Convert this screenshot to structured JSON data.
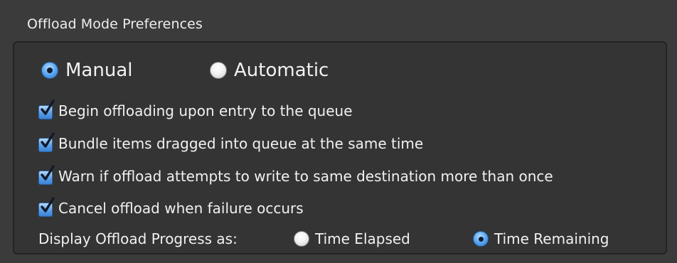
{
  "window": {
    "group_title": "Offload Mode Preferences"
  },
  "mode": {
    "options": [
      {
        "label": "Manual",
        "selected": true
      },
      {
        "label": "Automatic",
        "selected": false
      }
    ]
  },
  "options": {
    "items": [
      {
        "label": "Begin offloading upon entry to the queue",
        "checked": true
      },
      {
        "label": "Bundle items dragged into queue at the same time",
        "checked": true
      },
      {
        "label": "Warn if offload attempts to write to same destination more than once",
        "checked": true
      },
      {
        "label": "Cancel offload when failure occurs",
        "checked": true
      }
    ]
  },
  "progress_display": {
    "label": "Display Offload Progress as:",
    "options": [
      {
        "label": "Time Elapsed",
        "selected": false
      },
      {
        "label": "Time Remaining",
        "selected": true
      }
    ]
  },
  "colors": {
    "background": "#3b3b3b",
    "text": "#f1f1f1",
    "accent_blue": "#5aa6ef"
  },
  "icons": {
    "checkmark": "checkmark-icon"
  }
}
